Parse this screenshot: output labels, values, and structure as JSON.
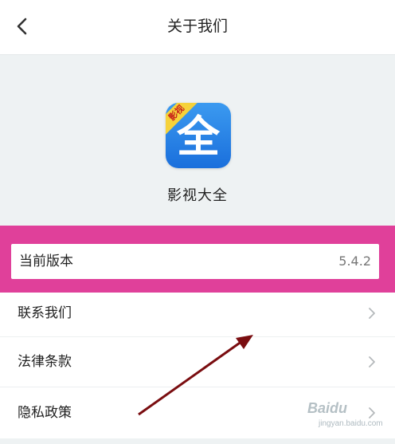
{
  "header": {
    "title": "关于我们"
  },
  "app": {
    "name": "影视大全",
    "logo_char": "全",
    "logo_ribbon": "影视"
  },
  "rows": {
    "version": {
      "label": "当前版本",
      "value": "5.4.2"
    },
    "contact": {
      "label": "联系我们"
    },
    "legal": {
      "label": "法律条款"
    },
    "privacy": {
      "label": "隐私政策"
    }
  },
  "watermark": {
    "text": "Baidu",
    "sub": "jingyan.baidu.com"
  },
  "colors": {
    "highlight": "#e0409a",
    "arrow": "#7a0d10",
    "logo_blue": "#1a6fdc",
    "ribbon": "#f6d23a"
  }
}
